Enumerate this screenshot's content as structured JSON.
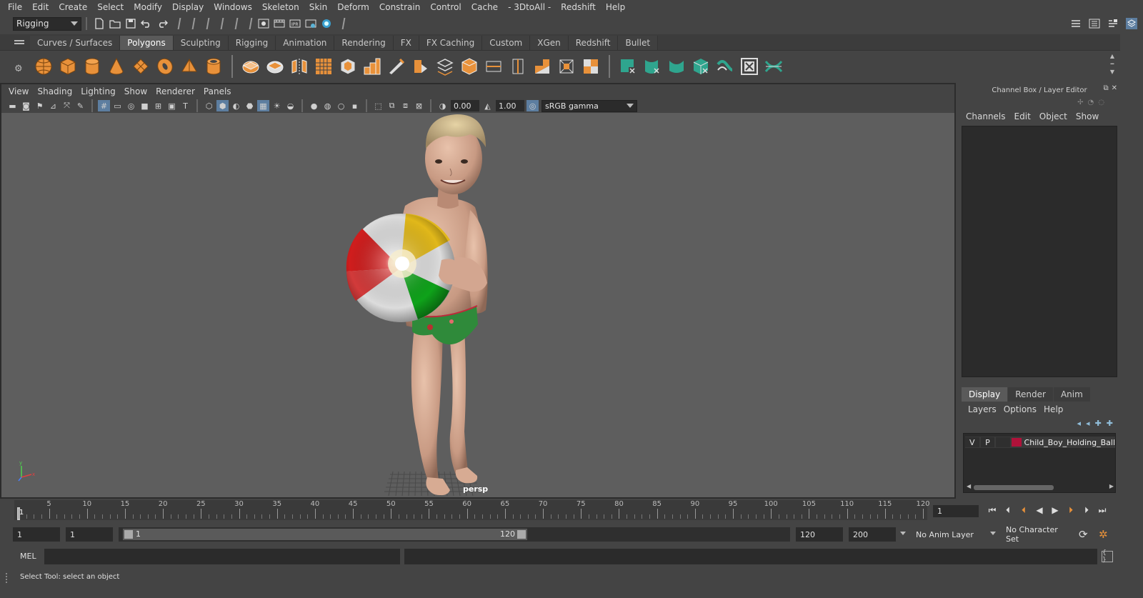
{
  "menubar": {
    "items": [
      "File",
      "Edit",
      "Create",
      "Select",
      "Modify",
      "Display",
      "Windows",
      "Skeleton",
      "Skin",
      "Deform",
      "Constrain",
      "Control",
      "Cache",
      "- 3DtoAll -",
      "Redshift",
      "Help"
    ]
  },
  "statusline": {
    "mode": "Rigging"
  },
  "shelf": {
    "tabs": [
      "Curves / Surfaces",
      "Polygons",
      "Sculpting",
      "Rigging",
      "Animation",
      "Rendering",
      "FX",
      "FX Caching",
      "Custom",
      "XGen",
      "Redshift",
      "Bullet"
    ],
    "active_tab": "Polygons",
    "orange_icons": [
      "sphere-icon",
      "cube-icon",
      "cylinder-icon",
      "cone-icon",
      "plane-icon",
      "torus-icon",
      "pyramid-icon",
      "pipe-icon"
    ],
    "tool_icons": [
      "combine-icon",
      "separate-icon",
      "mirror-icon",
      "smooth-icon",
      "bevel-icon",
      "extrude-icon",
      "bridge-icon",
      "multicut-icon",
      "target-weld-icon",
      "merge-icon",
      "slice-icon",
      "uv-editor-icon",
      "fill-hole-icon",
      "boolean-icon",
      "edge-loop-icon",
      "quad-draw-icon"
    ],
    "teal_icons": [
      "uv-planar-icon",
      "uv-cylindrical-icon",
      "uv-spherical-icon",
      "uv-auto-icon",
      "uv-unfold-icon",
      "uv-layout-icon",
      "uv-cut-icon"
    ]
  },
  "viewport": {
    "menu": [
      "View",
      "Shading",
      "Lighting",
      "Show",
      "Renderer",
      "Panels"
    ],
    "exposure": "0.00",
    "gamma_value": "1.00",
    "color_space": "sRGB gamma",
    "camera_label": "persp"
  },
  "channelbox": {
    "title": "Channel Box / Layer Editor",
    "menu": [
      "Channels",
      "Edit",
      "Object",
      "Show"
    ]
  },
  "layereditor": {
    "tabs": [
      "Display",
      "Render",
      "Anim"
    ],
    "active_tab": "Display",
    "menu": [
      "Layers",
      "Options",
      "Help"
    ],
    "layer": {
      "v": "V",
      "p": "P",
      "name": "Child_Boy_Holding_Ball_",
      "color": "#b0123a"
    }
  },
  "timeslider": {
    "labels": [
      "1",
      "5",
      "10",
      "15",
      "20",
      "25",
      "30",
      "35",
      "40",
      "45",
      "50",
      "55",
      "60",
      "65",
      "70",
      "75",
      "80",
      "85",
      "90",
      "95",
      "100",
      "105",
      "110",
      "115",
      "120"
    ],
    "current_frame": "1"
  },
  "rangeslider": {
    "start": "1",
    "playback_start": "1",
    "range_start_label": "1",
    "range_end_label": "120",
    "playback_end": "120",
    "end": "200",
    "anim_layer": "No Anim Layer",
    "character_set": "No Character Set"
  },
  "cmdline": {
    "label": "MEL"
  },
  "helpline": {
    "text": "Select Tool: select an object"
  }
}
